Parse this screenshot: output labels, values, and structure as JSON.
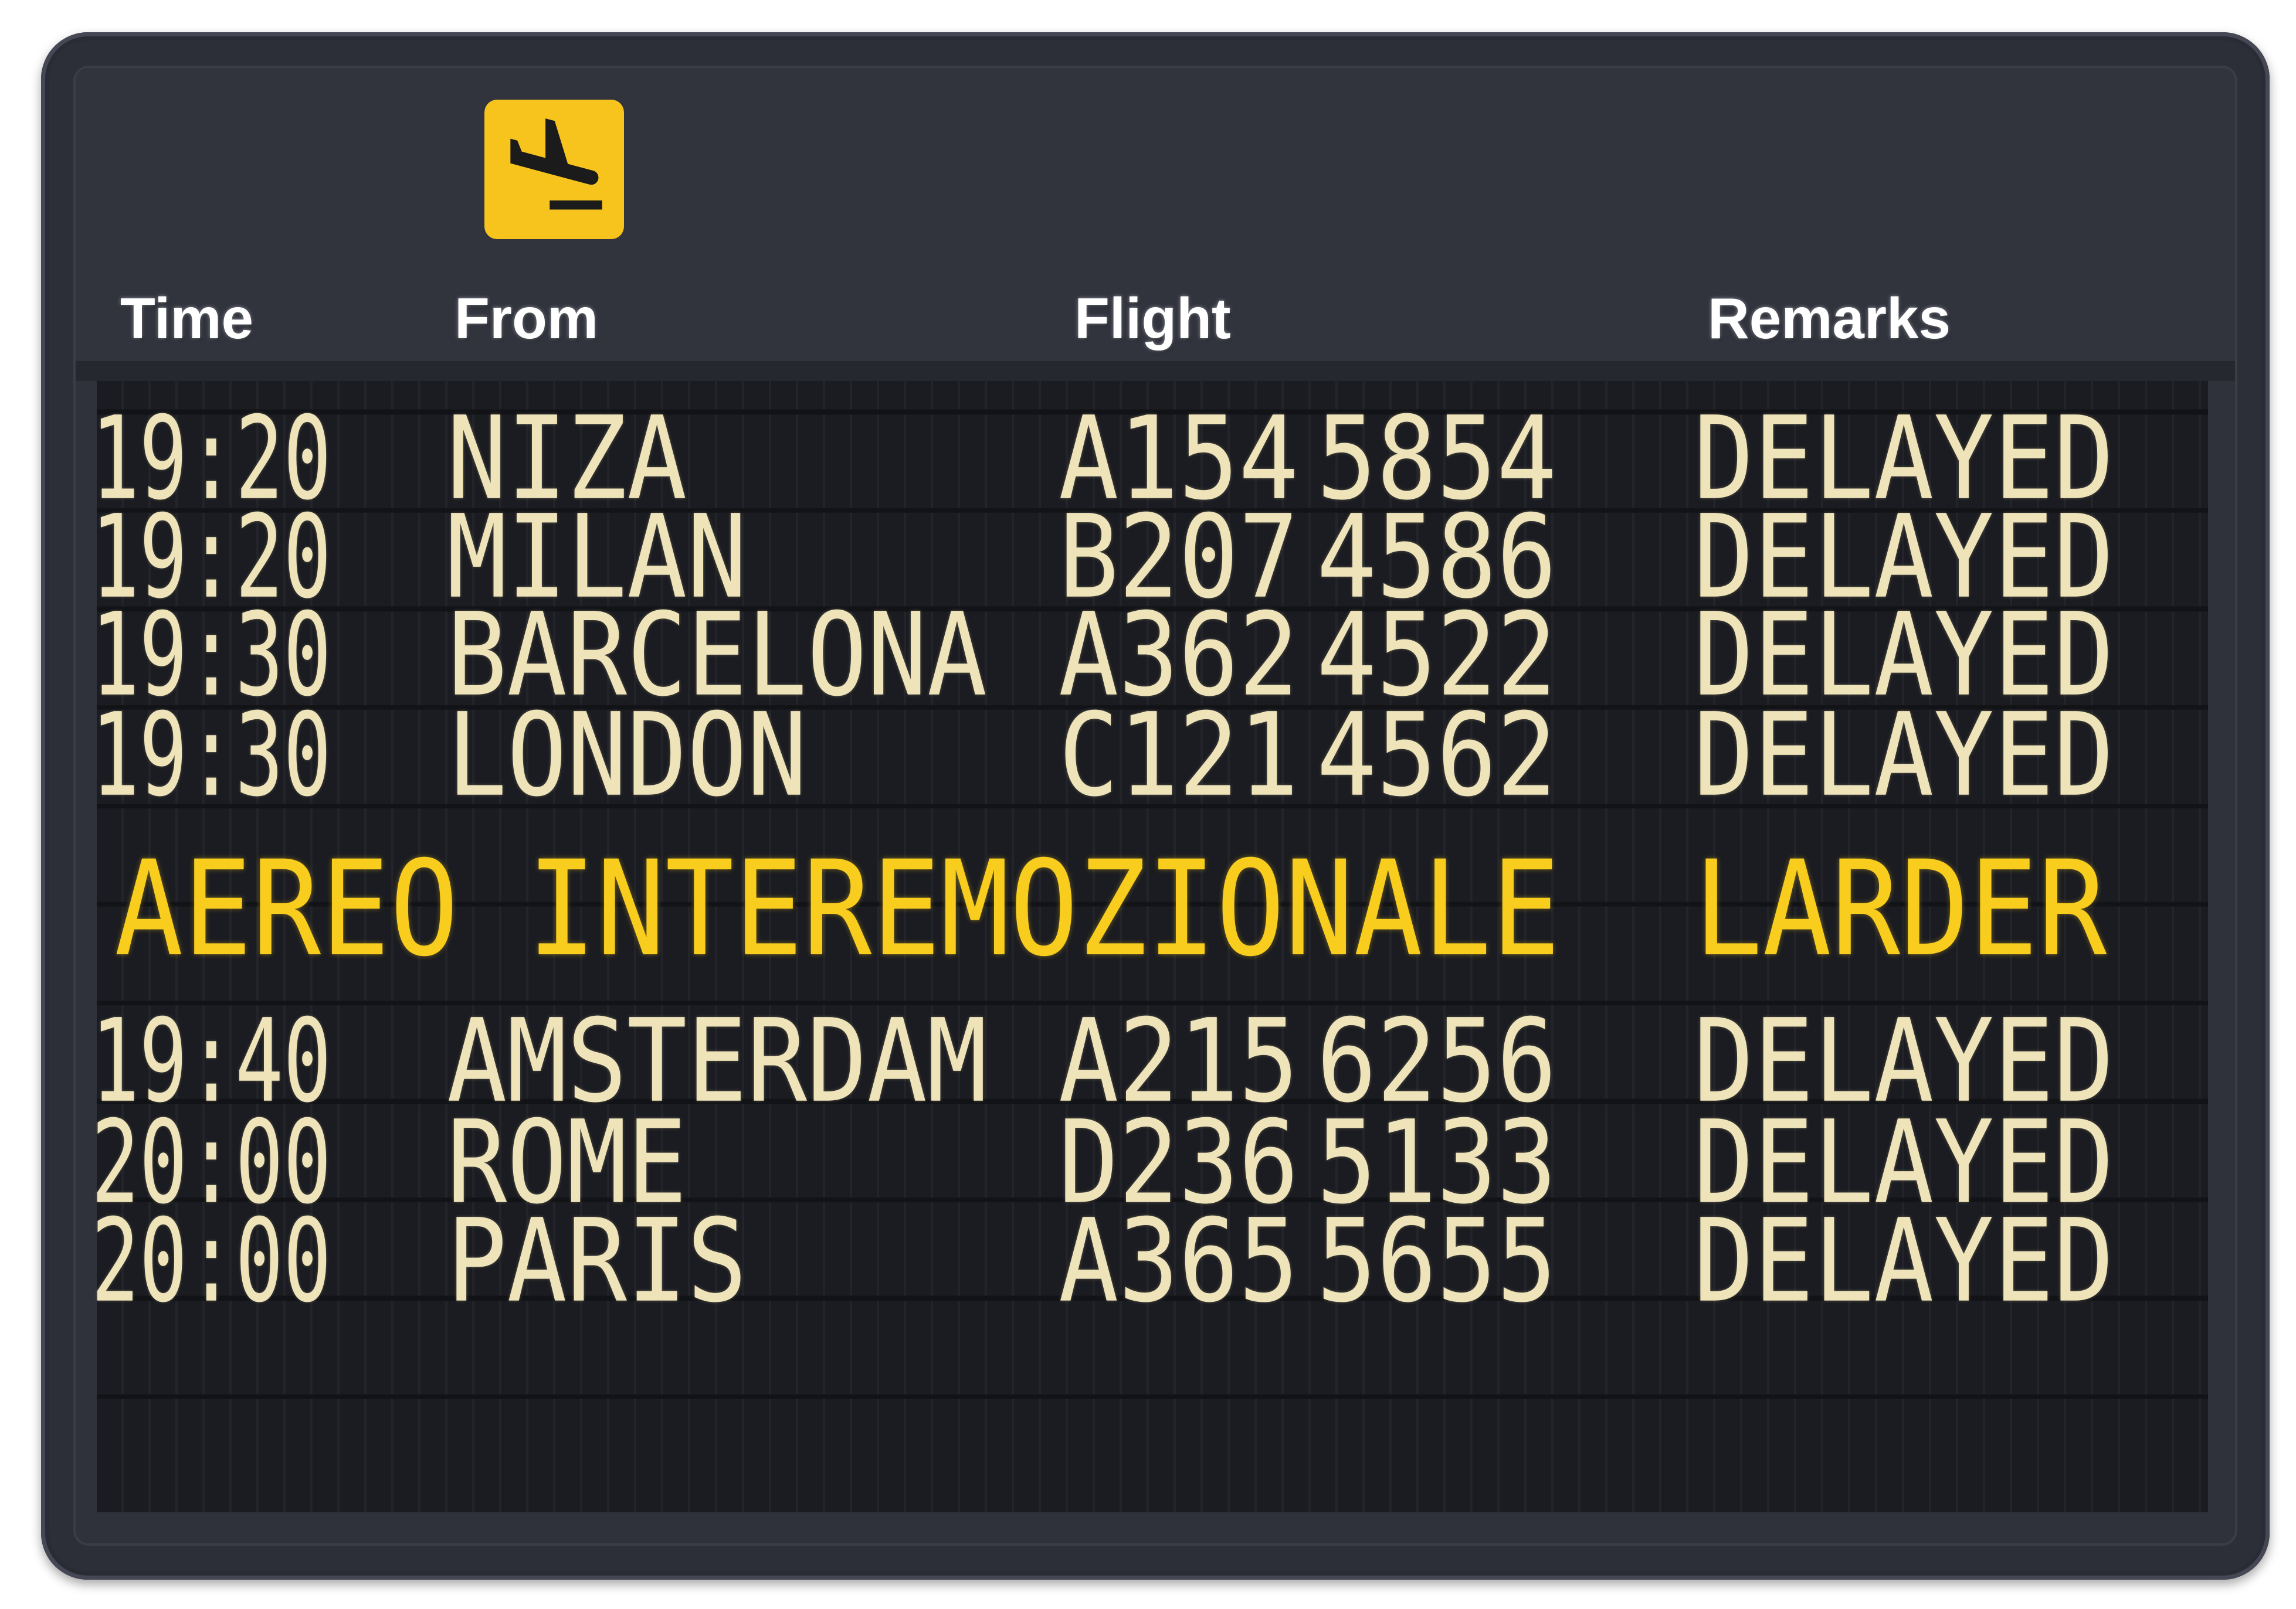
{
  "header": {
    "icon": "arrival-plane-icon",
    "columns": {
      "time": "Time",
      "from": "From",
      "flight": "Flight",
      "remarks": "Remarks"
    }
  },
  "flights": [
    {
      "time": "19:20",
      "from": "NIZA",
      "flight_code": "A154",
      "flight_number": "5854",
      "remarks": "DELAYED"
    },
    {
      "time": "19:20",
      "from": "MILAN",
      "flight_code": "B207",
      "flight_number": "4586",
      "remarks": "DELAYED"
    },
    {
      "time": "19:30",
      "from": "BARCELONA",
      "flight_code": "A362",
      "flight_number": "4522",
      "remarks": "DELAYED"
    },
    {
      "time": "19:30",
      "from": "LONDON",
      "flight_code": "C121",
      "flight_number": "4562",
      "remarks": "DELAYED"
    },
    {
      "time": "19:40",
      "from": "AMSTERDAM",
      "flight_code": "A215",
      "flight_number": "6256",
      "remarks": "DELAYED"
    },
    {
      "time": "20:00",
      "from": "ROME",
      "flight_code": "D236",
      "flight_number": "5133",
      "remarks": "DELAYED"
    },
    {
      "time": "20:00",
      "from": "PARIS",
      "flight_code": "A365",
      "flight_number": "5655",
      "remarks": "DELAYED"
    }
  ],
  "banner": {
    "message": "AEREO INTEREMOZIONALE",
    "status": "LARDER"
  },
  "colors": {
    "board_frame": "#2c2e38",
    "display_grid": "#1b1c21",
    "header_text": "#ffffff",
    "display_text": "#efe4b9",
    "banner_text": "#f8cd1e",
    "icon_background": "#f6c41c"
  }
}
